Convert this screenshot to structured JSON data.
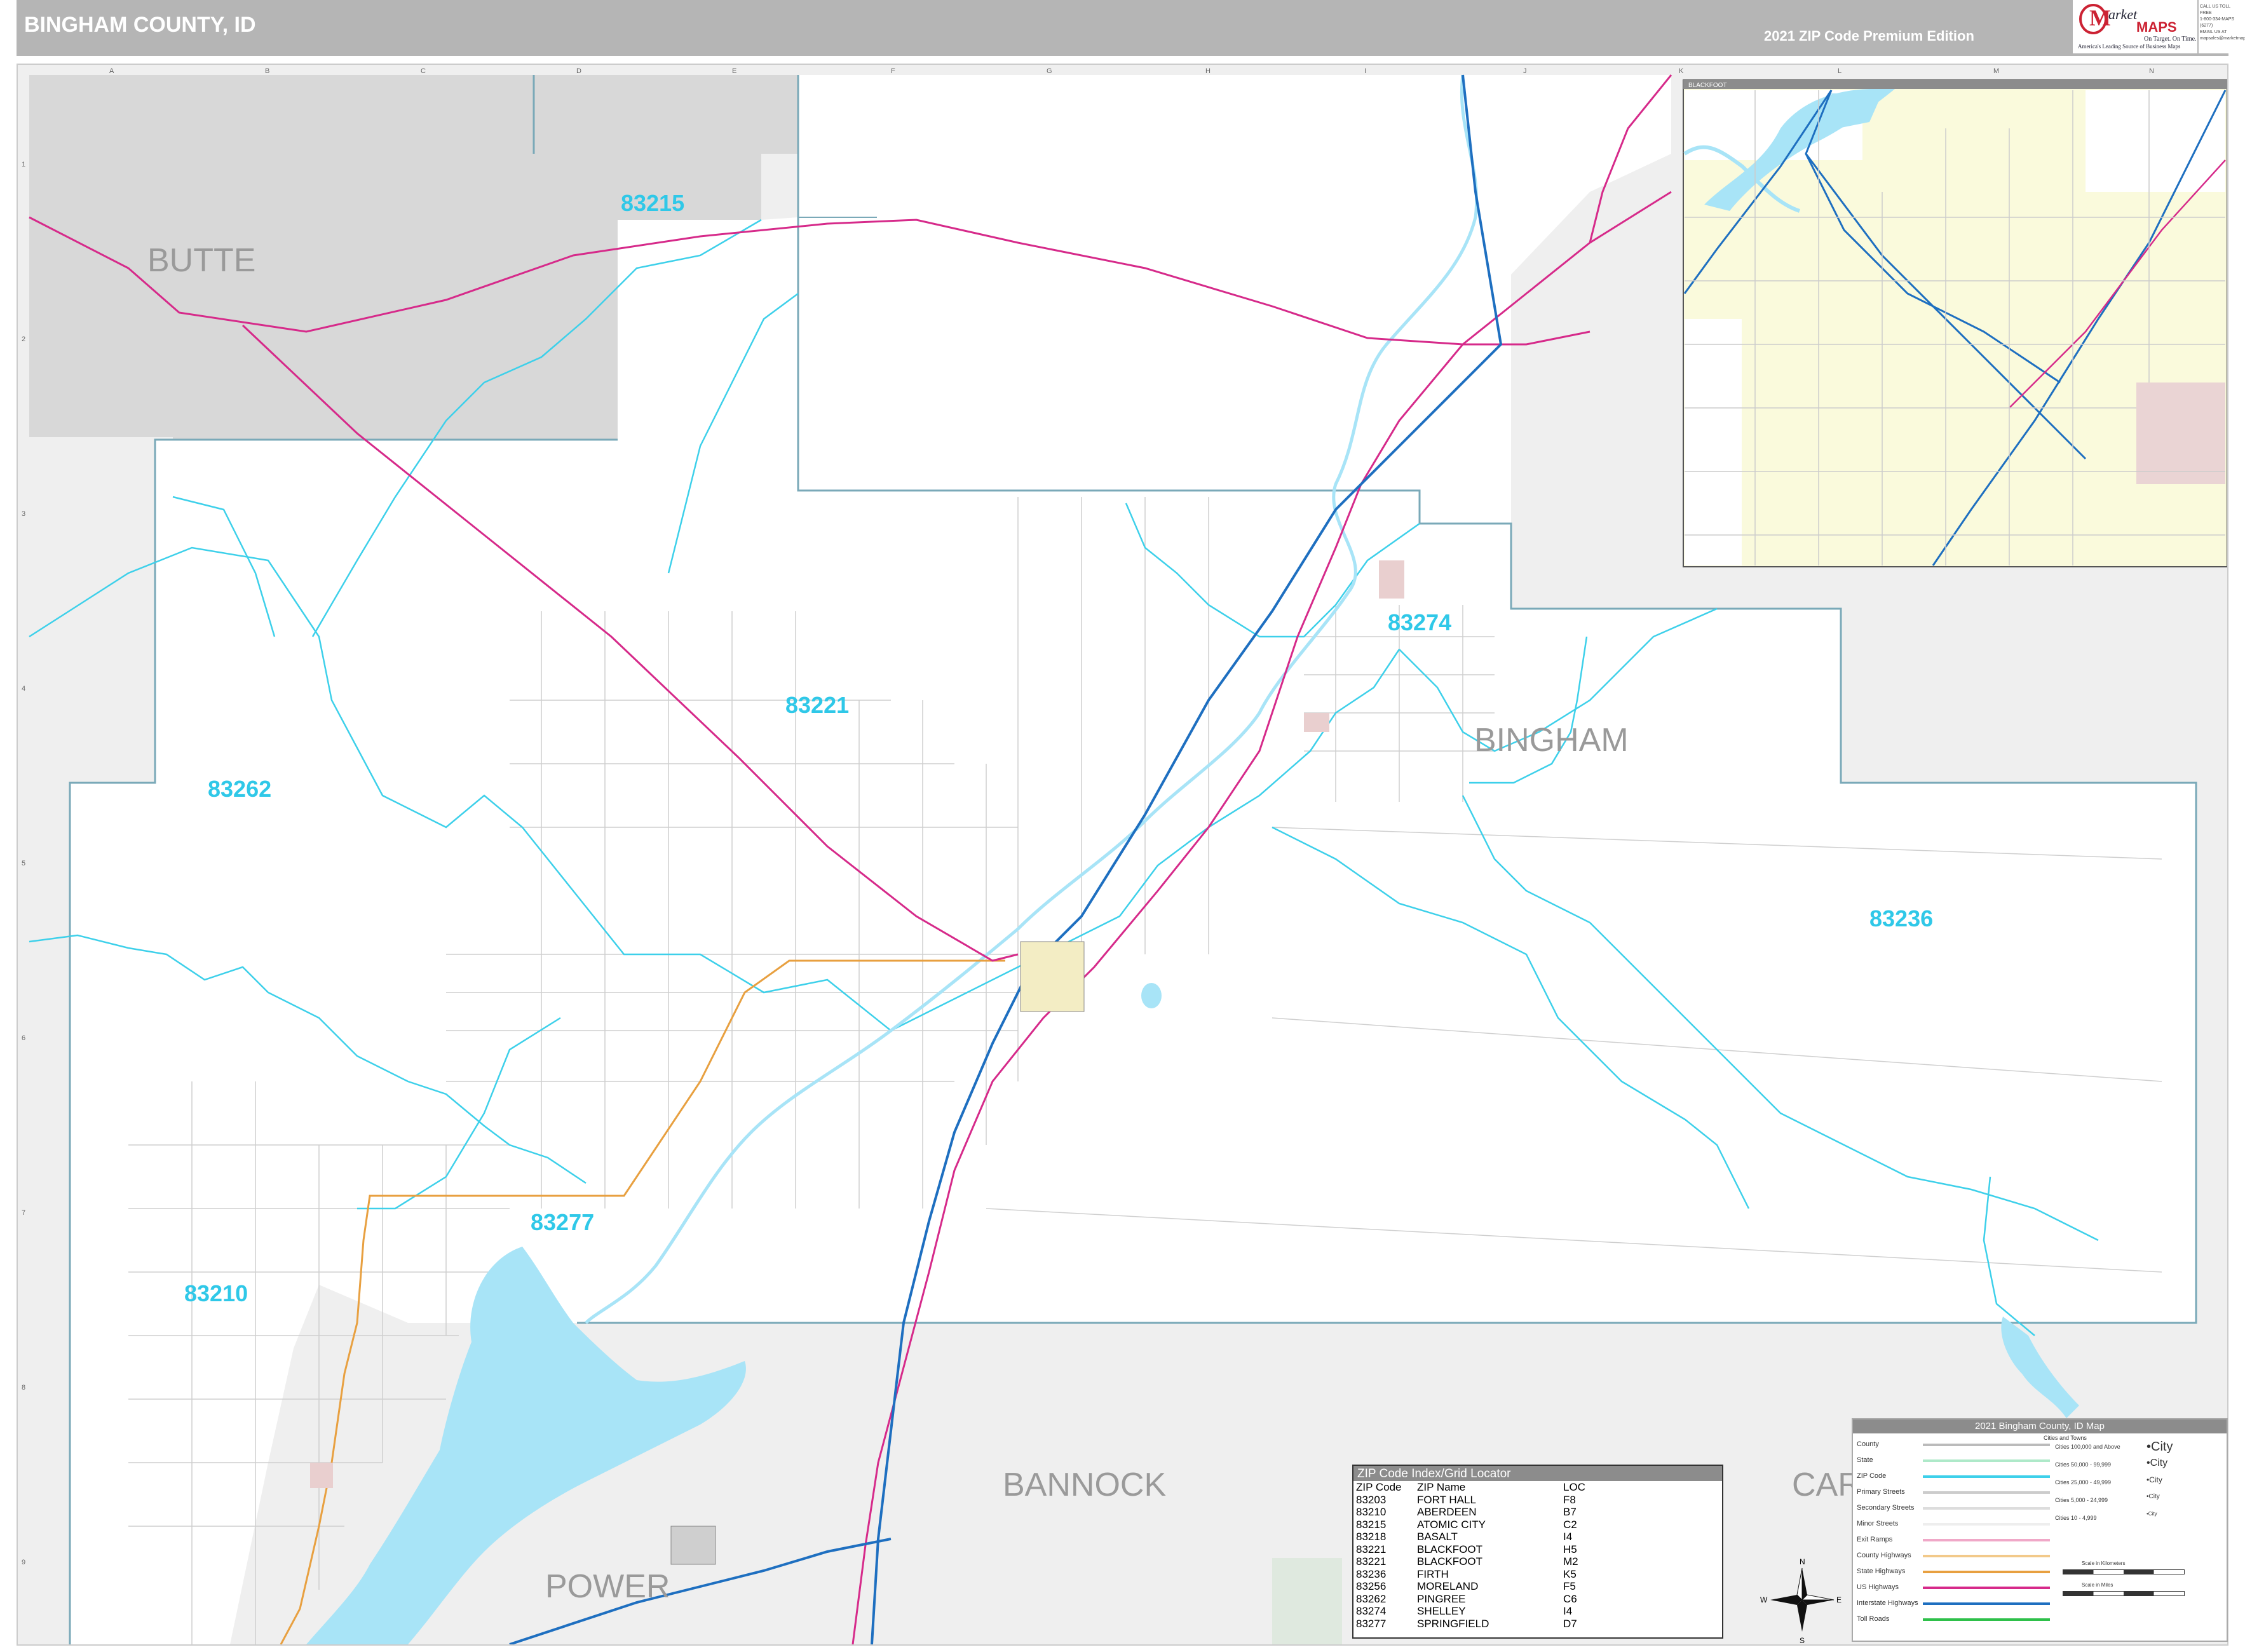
{
  "header": {
    "title": "BINGHAM COUNTY, ID",
    "edition": "2021 ZIP Code Premium Edition",
    "logo_text": "Market MAPS",
    "logo_tagline": "On Target. On Time.",
    "logo_subtitle": "America's Leading Source of Business Maps",
    "contact_lines": [
      "CALL US TOLL FREE",
      "1-800-334-MAPS (6277)",
      "EMAIL US AT",
      "mapsales@marketmaps.com"
    ]
  },
  "grid": {
    "columns": [
      "A",
      "B",
      "C",
      "D",
      "E",
      "F",
      "G",
      "H",
      "I",
      "J",
      "K",
      "L",
      "M",
      "N"
    ],
    "rows": [
      "1",
      "2",
      "3",
      "4",
      "5",
      "6",
      "7",
      "8",
      "9"
    ]
  },
  "counties": {
    "butte": "BUTTE",
    "bingham": "BINGHAM",
    "bannock": "BANNOCK",
    "power": "POWER",
    "caribou": "CAR"
  },
  "zip_labels": {
    "z83215": "83215",
    "z83221": "83221",
    "z83262": "83262",
    "z83274": "83274",
    "z83236": "83236",
    "z83277": "83277",
    "z83210": "83210"
  },
  "inset": {
    "label": "BLACKFOOT"
  },
  "zip_index": {
    "title": "ZIP Code Index/Grid Locator",
    "headers": [
      "ZIP Code",
      "ZIP Name",
      "LOC"
    ],
    "rows": [
      {
        "zip": "83203",
        "name": "FORT HALL",
        "loc": "F8"
      },
      {
        "zip": "83210",
        "name": "ABERDEEN",
        "loc": "B7"
      },
      {
        "zip": "83215",
        "name": "ATOMIC CITY",
        "loc": "C2"
      },
      {
        "zip": "83218",
        "name": "BASALT",
        "loc": "I4"
      },
      {
        "zip": "83221",
        "name": "BLACKFOOT",
        "loc": "H5"
      },
      {
        "zip": "83221",
        "name": "BLACKFOOT",
        "loc": "M2"
      },
      {
        "zip": "83236",
        "name": "FIRTH",
        "loc": "K5"
      },
      {
        "zip": "83256",
        "name": "MORELAND",
        "loc": "F5"
      },
      {
        "zip": "83262",
        "name": "PINGREE",
        "loc": "C6"
      },
      {
        "zip": "83274",
        "name": "SHELLEY",
        "loc": "I4"
      },
      {
        "zip": "83277",
        "name": "SPRINGFIELD",
        "loc": "D7"
      }
    ]
  },
  "legend": {
    "title": "2021 Bingham County, ID Map",
    "items": [
      "County",
      "State",
      "ZIP Code",
      "Primary Streets",
      "Secondary Streets",
      "Minor Streets",
      "Exit Ramps",
      "County Highways",
      "State Highways",
      "US Highways",
      "Interstate Highways",
      "Toll Roads"
    ],
    "cities_header": "Cities and Towns",
    "cities": [
      {
        "label": "Cities 100,000 and Above",
        "mark": "•City"
      },
      {
        "label": "Cities 50,000 - 99,999",
        "mark": "•City"
      },
      {
        "label": "Cities 25,000 - 49,999",
        "mark": "•City"
      },
      {
        "label": "Cities 5,000 - 24,999",
        "mark": "•City"
      },
      {
        "label": "Cities 10 - 4,999",
        "mark": "•City"
      }
    ],
    "scale_km": "Scale in Kilometers",
    "scale_mi": "Scale in Miles"
  },
  "compass": {
    "n": "N",
    "s": "S",
    "e": "E",
    "w": "W"
  },
  "colors": {
    "zip_line": "#3dd0ea",
    "us_highway": "#d62a8a",
    "interstate": "#1e6fc0",
    "state_highway": "#e8a040",
    "water": "#a8e4f7",
    "outside": "#eeeeee",
    "butte_shade": "#d9d9d9",
    "inset_fill": "#fafadc"
  }
}
